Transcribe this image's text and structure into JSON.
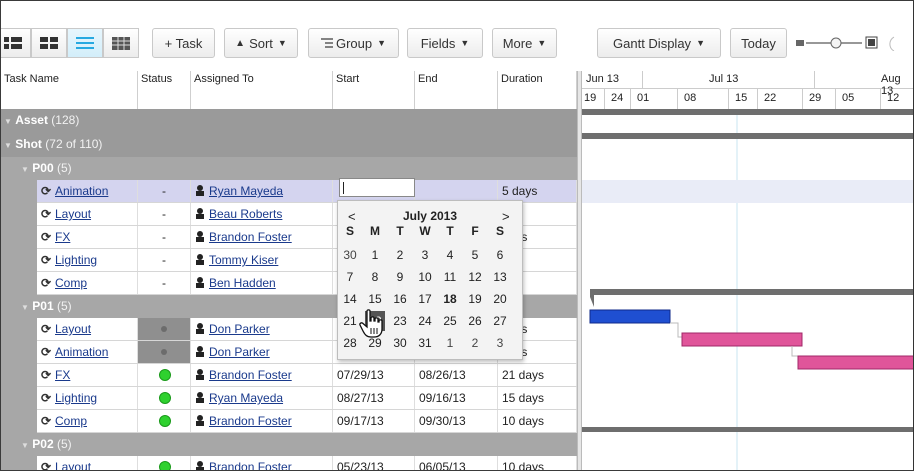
{
  "toolbar": {
    "add_task": "+ Task",
    "sort": "Sort",
    "group": "Group",
    "fields": "Fields",
    "more": "More",
    "gantt_display": "Gantt Display",
    "today": "Today"
  },
  "grid": {
    "headers": {
      "task_name": "Task Name",
      "status": "Status",
      "assigned": "Assigned To",
      "start": "Start",
      "end": "End",
      "duration": "Duration"
    },
    "asset": {
      "name": "Asset",
      "count": "(128)"
    },
    "shot": {
      "name": "Shot",
      "count": "(72 of 110)"
    },
    "p00": {
      "name": "P00",
      "count": "(5)"
    },
    "p01": {
      "name": "P01",
      "count": "(5)"
    },
    "p02": {
      "name": "P02",
      "count": "(5)"
    },
    "rows": [
      {
        "name": "Animation",
        "status": "-",
        "assigned": "Ryan Mayeda",
        "start": "",
        "end": "",
        "duration": "5 days"
      },
      {
        "name": "Layout",
        "status": "-",
        "assigned": "Beau Roberts",
        "start": "",
        "end": "",
        "duration": "ays"
      },
      {
        "name": "FX",
        "status": "-",
        "assigned": "Brandon Foster",
        "start": "",
        "end": "",
        "duration": "days"
      },
      {
        "name": "Lighting",
        "status": "-",
        "assigned": "Tommy Kiser",
        "start": "",
        "end": "",
        "duration": "ays"
      },
      {
        "name": "Comp",
        "status": "-",
        "assigned": "Ben Hadden",
        "start": "",
        "end": "",
        "duration": "ays"
      },
      {
        "name": "Layout",
        "status": "",
        "assigned": "Don Parker",
        "start": "",
        "end": "",
        "duration": "days"
      },
      {
        "name": "Animation",
        "status": "",
        "assigned": "Don Parker",
        "start": "",
        "end": "",
        "duration": "days"
      },
      {
        "name": "FX",
        "status": "",
        "assigned": "Brandon Foster",
        "start": "07/29/13",
        "end": "08/26/13",
        "duration": "21 days"
      },
      {
        "name": "Lighting",
        "status": "",
        "assigned": "Ryan Mayeda",
        "start": "08/27/13",
        "end": "09/16/13",
        "duration": "15 days"
      },
      {
        "name": "Comp",
        "status": "",
        "assigned": "Brandon Foster",
        "start": "09/17/13",
        "end": "09/30/13",
        "duration": "10 days"
      },
      {
        "name": "Layout",
        "status": "",
        "assigned": "Brandon Foster",
        "start": "05/23/13",
        "end": "06/05/13",
        "duration": "10 days"
      }
    ]
  },
  "gantt": {
    "months": [
      "Jun 13",
      "Jul 13",
      "Aug 13"
    ],
    "weeks": [
      "19",
      "24",
      "01",
      "08",
      "15",
      "22",
      "29",
      "05",
      "12"
    ]
  },
  "datepicker": {
    "prev": "<",
    "next": ">",
    "month": "July 2013",
    "dow": [
      "S",
      "M",
      "T",
      "W",
      "T",
      "F",
      "S"
    ],
    "weeks": [
      [
        "30",
        "1",
        "2",
        "3",
        "4",
        "5",
        "6"
      ],
      [
        "7",
        "8",
        "9",
        "10",
        "11",
        "12",
        "13"
      ],
      [
        "14",
        "15",
        "16",
        "17",
        "18",
        "19",
        "20"
      ],
      [
        "21",
        "22",
        "23",
        "24",
        "25",
        "26",
        "27"
      ],
      [
        "28",
        "29",
        "30",
        "31",
        "1",
        "2",
        "3"
      ]
    ]
  },
  "colors": {
    "gantt_bar_blue": "#1f4fd1",
    "gantt_bar_pink": "#e0559a",
    "status_green": "#2fd12f"
  }
}
